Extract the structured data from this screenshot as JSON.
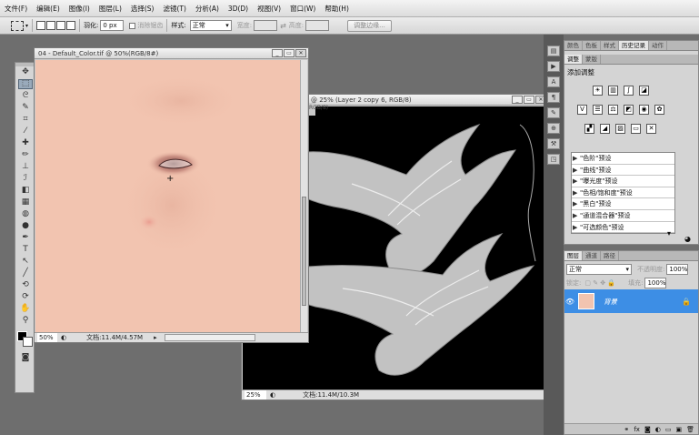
{
  "menu": [
    "文件(F)",
    "编辑(E)",
    "图像(I)",
    "图层(L)",
    "选择(S)",
    "滤镜(T)",
    "分析(A)",
    "3D(D)",
    "视图(V)",
    "窗口(W)",
    "帮助(H)"
  ],
  "options": {
    "feather_label": "羽化:",
    "feather_value": "0 px",
    "antialias_label": "消除锯齿",
    "style_label": "样式:",
    "style_value": "正常",
    "width_label": "宽度:",
    "height_label": "高度:",
    "refine_edge": "调整边缘..."
  },
  "doc1": {
    "title": "04 - Default_Color.tif @ 50%(RGB/8#)",
    "zoom": "50%",
    "status": "文档:11.4M/4.57M",
    "bg": "#f2c4b0"
  },
  "doc2": {
    "title": "@ 25% (Layer 2 copy 6, RGB/8)",
    "title_rgb": "RGB/8)",
    "zoom": "25%",
    "status": "文档:11.4M/10.3M"
  },
  "panel_top": {
    "tabs": [
      "颜色",
      "色板",
      "样式",
      "历史记录",
      "动作"
    ],
    "adj_tabs": [
      "调整",
      "蒙版"
    ],
    "adj_title": "添加调整",
    "presets": [
      "\"色阶\"预设",
      "\"曲线\"预设",
      "\"曝光度\"预设",
      "\"色相/饱和度\"预设",
      "\"黑白\"预设",
      "\"通道混合器\"预设",
      "\"可选颜色\"预设"
    ]
  },
  "panel_layers": {
    "tabs": [
      "图层",
      "通道",
      "路径"
    ],
    "blend_mode": "正常",
    "opacity_label": "不透明度:",
    "opacity": "100%",
    "lock_label": "锁定:",
    "fill_label": "填充:",
    "fill": "100%",
    "layer_name": "背景"
  },
  "colors": {
    "accent": "#3d8ee5",
    "skin": "#f2c4b0"
  }
}
